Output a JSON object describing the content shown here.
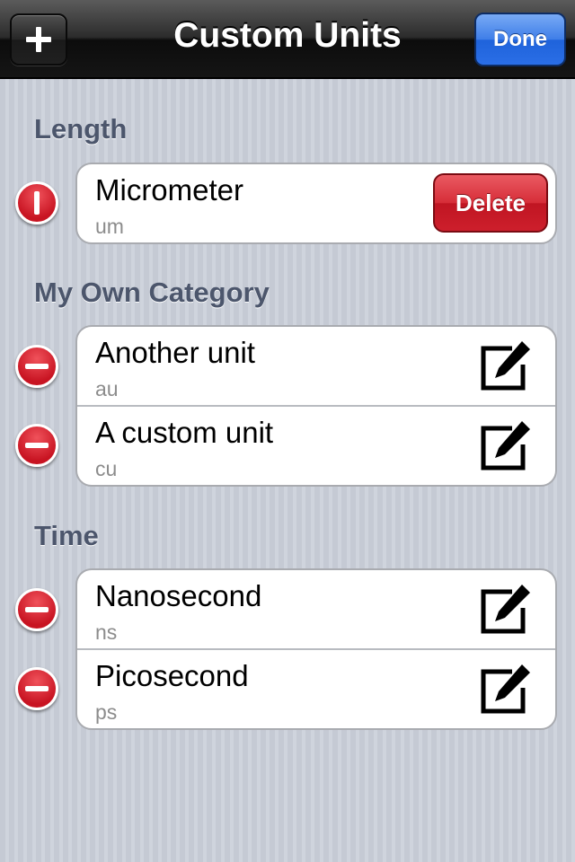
{
  "nav": {
    "title": "Custom Units",
    "add_icon": "plus-icon",
    "done_label": "Done"
  },
  "sections": [
    {
      "header": "Length",
      "rows": [
        {
          "name": "Micrometer",
          "symbol": "um",
          "delete_label": "Delete",
          "delete_confirm_visible": true
        }
      ]
    },
    {
      "header": "My Own Category",
      "rows": [
        {
          "name": "Another unit",
          "symbol": "au",
          "edit_icon": "edit-icon"
        },
        {
          "name": "A custom unit",
          "symbol": "cu",
          "edit_icon": "edit-icon"
        }
      ]
    },
    {
      "header": "Time",
      "rows": [
        {
          "name": "Nanosecond",
          "symbol": "ns",
          "edit_icon": "edit-icon"
        },
        {
          "name": "Picosecond",
          "symbol": "ps",
          "edit_icon": "edit-icon"
        }
      ]
    }
  ],
  "colors": {
    "nav_dark": "#151515",
    "done_blue": "#2a6ee6",
    "delete_red": "#cd1f2c",
    "header_text": "#4c566c",
    "background": "#c7ccd6"
  }
}
